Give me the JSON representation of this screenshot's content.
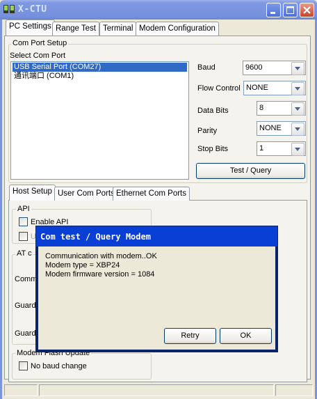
{
  "window": {
    "title": "X-CTU"
  },
  "tabs": [
    "PC Settings",
    "Range Test",
    "Terminal",
    "Modem Configuration"
  ],
  "com_port_setup": {
    "legend": "Com Port Setup",
    "select_label": "Select Com Port",
    "ports": [
      "USB Serial Port (COM27)",
      "通讯端口 (COM1)"
    ],
    "selected_index": 0
  },
  "settings": {
    "baud_label": "Baud",
    "baud": "9600",
    "flow_label": "Flow Control",
    "flow": "NONE",
    "data_bits_label": "Data Bits",
    "data_bits": "8",
    "parity_label": "Parity",
    "parity": "NONE",
    "stop_bits_label": "Stop Bits",
    "stop_bits": "1",
    "test_button": "Test / Query"
  },
  "host_tabs": [
    "Host Setup",
    "User Com Ports",
    "Ethernet Com Ports"
  ],
  "host_setup": {
    "api_legend": "API",
    "enable_api": "Enable API",
    "use_escape_partial": "U",
    "at_legend_partial": "AT c",
    "command_partial": "Comm",
    "guard1_partial": "Guard",
    "guard2_partial": "Guard",
    "modem_flash_legend": "Modem Flash Update",
    "no_baud_change": "No baud change"
  },
  "dialog": {
    "title": "Com test / Query Modem",
    "lines": [
      "Communication with modem..OK",
      "Modem type = XBP24",
      "Modem firmware version = 1084"
    ],
    "retry": "Retry",
    "ok": "OK"
  },
  "colors": {
    "titlebar": "#7a94df",
    "dialog_title": "#0a3fd5",
    "selection": "#316ac5",
    "face": "#ece9d8"
  }
}
